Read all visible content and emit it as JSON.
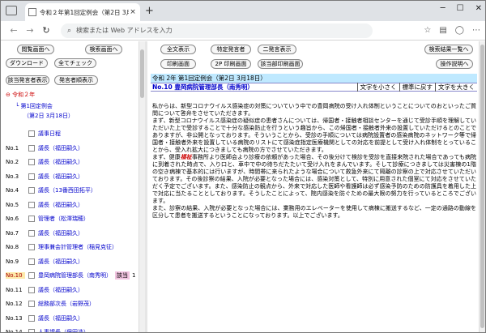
{
  "browser": {
    "tab_title": "令和２年第1回定例会（第2日 3月1",
    "address_placeholder": "検索または Web アドレスを入力",
    "new_tab": "+",
    "close": "×",
    "back": "←",
    "forward": "→",
    "reload": "↻",
    "minimize": "─",
    "maximize": "☐",
    "close_window": "✕"
  },
  "left_buttons": {
    "view_screen": "閲覧画面へ",
    "search_screen": "検索画面へ",
    "download": "ダウンロード",
    "check_all": "全てチェック",
    "speaker_display": "該当発言者表示",
    "speaker_list": "発言者順表示"
  },
  "tree": {
    "year": "令和２年",
    "session": "第1回定例会",
    "day": "（第2日 3月18日）"
  },
  "speakers": [
    {
      "no": "",
      "name": "議事日程"
    },
    {
      "no": "No.1",
      "name": "議長（福田嗣久）"
    },
    {
      "no": "No.2",
      "name": "議長（福田嗣久）"
    },
    {
      "no": "No.3",
      "name": "議長（福田嗣久）"
    },
    {
      "no": "No.4",
      "name": "議長（13番西田拓平）"
    },
    {
      "no": "No.5",
      "name": "議長（福田嗣久）"
    },
    {
      "no": "No.6",
      "name": "管理者（松澤瑞穂）"
    },
    {
      "no": "No.7",
      "name": "議長（福田嗣久）"
    },
    {
      "no": "No.8",
      "name": "理事兼会計管理者（稲見克征）"
    },
    {
      "no": "No.9",
      "name": "議長（福田嗣久）"
    },
    {
      "no": "No.10",
      "name": "豊岡病院管理部長（南秀明）",
      "tag": "該当",
      "count": "1",
      "selected": true
    },
    {
      "no": "No.11",
      "name": "議長（福田嗣久）"
    },
    {
      "no": "No.12",
      "name": "総務部次長（岩野茂）"
    },
    {
      "no": "No.13",
      "name": "議長（福田嗣久）"
    },
    {
      "no": "No.14",
      "name": "人事課長（保田浩）"
    }
  ],
  "right_buttons": {
    "full_text": "全文表示",
    "specific_speaker": "特定発言者",
    "two_column": "二発言表示",
    "search_result": "検索結果一覧へ",
    "print_screen": "印刷画面",
    "two_print": "2P 印刷画面",
    "speaker_print": "該当部印刷画面",
    "help": "操作説明へ"
  },
  "meeting_title": "令和 2年 第1回定例会（第2日 3月18日）",
  "speaker_header": "No.10 豊岡病院管理部長（南秀明）",
  "controls": {
    "smaller": "文字を小さく",
    "standard": "標準に戻す",
    "larger": "文字を大きく"
  },
  "body_text": {
    "p1": "私からは、新型コロナウイルス感染症の対策についていう中での豊岡病院の受け入れ体制ということについてのおといったご質問について答弁をさせていただきます。",
    "p2": "まず、新型コロナウイルス感染症の疑似症の患者さんについては、帰国者・接触者相談センターを通じて受診手順を理解していただいた上で受診することで十分な感染防止を行うという趣旨から、この帰国者・接触者外来の設置していただけるとのことでありますが、非公開となっております。そういうことから、受診の手順については病院設置者の感染病院のネットワーク等で帰国者・接触者外来を設置している病院のリストにて感染症指定医療機関としての対応を前提として受け入れ体制をとっていることから、受入れ拡大につきましても病院の方でさせていただきます。",
    "p3_pre": "まず、健康",
    "p3_hl": "福祉",
    "p3_post": "事務所より医師会より診療の依頼があった場合、その後分けて検診を受診を直接来院された場合であっても病院に到着された時点で、入り口と、車中で中の待ちだたたいて受け入れをまんでいます。そして診療につきましては災害棟の1階の空き病棟で基本的には行いますが、時間帯に来られたような場合について救急外来にて隔離の診察の上で対応させていただいております。その後診察の結果、入院が必要となった場合には、感染対策として、特別に用意された個室にて対応をさせていただく予定でございます。また、感染防止の観点から、外来で対応した医師や看護師は必ず感染予防のための防護具を着用した上で対応に当たることとしております。そうしたことによって、院内感染を防ぐための最大限の努力を行っているところでございます。",
    "p4": "また、診察の結果、入院が必要となった場合には、業務用のエレベーターを使用して病棟に搬送するなど、一定の通路の動線を区分して患者を搬送するということになっております。以上でございます。"
  }
}
